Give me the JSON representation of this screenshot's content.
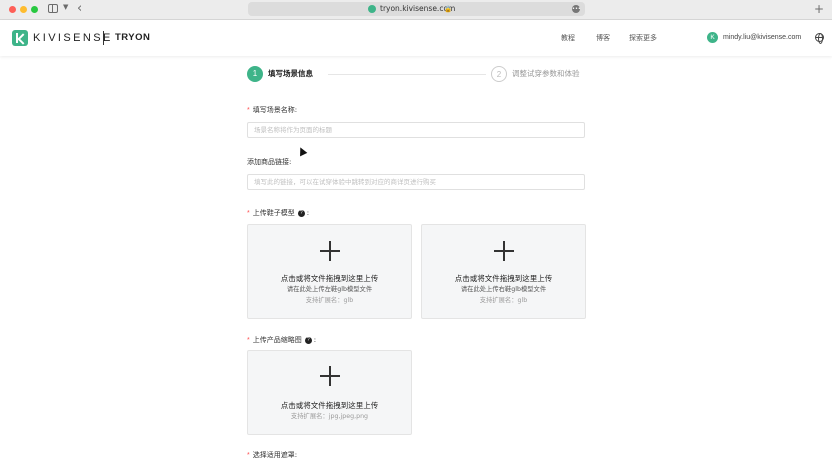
{
  "browser": {
    "url": "tryon.kivisense.com",
    "lock_icon": "lock-icon",
    "new_tab_label": "+"
  },
  "header": {
    "logo_text": "KIVISENSE",
    "product_name": "TRYON",
    "nav": [
      "教程",
      "博客",
      "探索更多"
    ],
    "avatar_letter": "K",
    "user_email": "mindy.liu@kivisense.com",
    "accent_color": "#3eb489"
  },
  "stepper": {
    "steps": [
      {
        "number": "1",
        "label": "填写场景信息",
        "active": true
      },
      {
        "number": "2",
        "label": "调整试穿参数和体验",
        "active": false
      }
    ]
  },
  "form": {
    "scene_name": {
      "required": "*",
      "label": "填写场景名称:",
      "placeholder": "场景名称将作为页面的标题",
      "value": ""
    },
    "product_link": {
      "label": "添加商品链接:",
      "placeholder": "填写此的链接，可以在试穿体验中跳转到对应的商详页进行购买",
      "value": ""
    },
    "shoe_model": {
      "required": "*",
      "label": "上传鞋子模型",
      "colon": ":",
      "left": {
        "title": "点击或将文件拖拽到这里上传",
        "hint": "请在此处上传左鞋glb模型文件",
        "ext": "支持扩展名：glb"
      },
      "right": {
        "title": "点击或将文件拖拽到这里上传",
        "hint": "请在此处上传右鞋glb模型文件",
        "ext": "支持扩展名：glb"
      }
    },
    "thumbnail": {
      "required": "*",
      "label": "上传产品缩略图",
      "colon": ":",
      "title": "点击或将文件拖拽到这里上传",
      "ext": "支持扩展名：jpg,jpeg,png"
    },
    "occlusion": {
      "required": "*",
      "label": "选择适用遮罩",
      "colon": ":"
    }
  }
}
